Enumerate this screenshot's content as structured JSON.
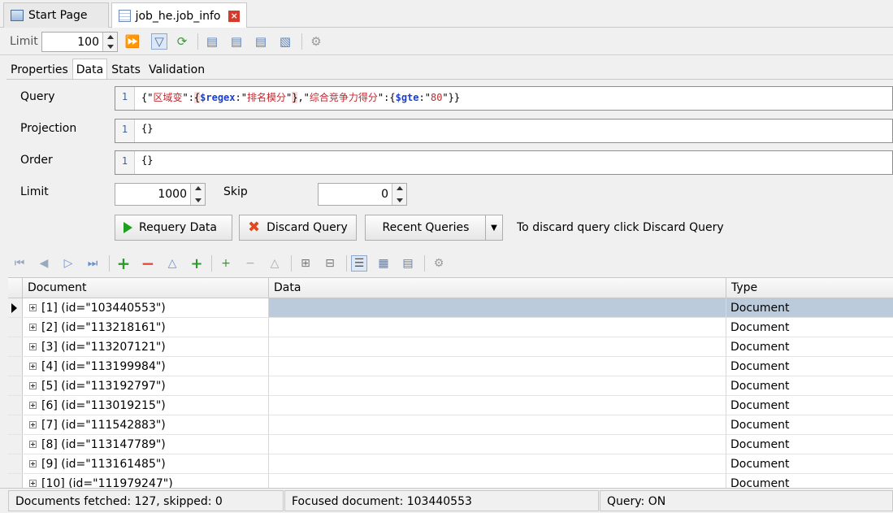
{
  "tabs": [
    {
      "label": "Start Page"
    },
    {
      "label": "job_he.job_info"
    }
  ],
  "toolbar": {
    "limit_label": "Limit",
    "limit_value": "100"
  },
  "subtabs": [
    "Properties",
    "Data",
    "Stats",
    "Validation"
  ],
  "query": {
    "query_label": "Query",
    "query_line": "1",
    "query_parts": [
      "{\"",
      "区域变",
      "\":",
      "{",
      "$regex",
      ":\"",
      "排名模分",
      "\"",
      "}",
      ",\"",
      "综合竞争力得分",
      "\":{",
      "$gte",
      ":\"",
      "80",
      "\"}}"
    ],
    "projection_label": "Projection",
    "projection_line": "1",
    "projection_code": "{}",
    "order_label": "Order",
    "order_line": "1",
    "order_code": "{}",
    "limit_label": "Limit",
    "limit_value": "1000",
    "skip_label": "Skip",
    "skip_value": "0",
    "requery_button": "Requery Data",
    "discard_button": "Discard Query",
    "recent_button": "Recent Queries",
    "hint": "To discard query click Discard Query"
  },
  "grid": {
    "columns": [
      "Document",
      "Data",
      "Type"
    ],
    "rows": [
      {
        "doc": "[1] (id=\"103440553\")",
        "data": "",
        "type": "Document"
      },
      {
        "doc": "[2] (id=\"113218161\")",
        "data": "",
        "type": "Document"
      },
      {
        "doc": "[3] (id=\"113207121\")",
        "data": "",
        "type": "Document"
      },
      {
        "doc": "[4] (id=\"113199984\")",
        "data": "",
        "type": "Document"
      },
      {
        "doc": "[5] (id=\"113192797\")",
        "data": "",
        "type": "Document"
      },
      {
        "doc": "[6] (id=\"113019215\")",
        "data": "",
        "type": "Document"
      },
      {
        "doc": "[7] (id=\"111542883\")",
        "data": "",
        "type": "Document"
      },
      {
        "doc": "[8] (id=\"113147789\")",
        "data": "",
        "type": "Document"
      },
      {
        "doc": "[9] (id=\"113161485\")",
        "data": "",
        "type": "Document"
      },
      {
        "doc": "[10] (id=\"111979247\")",
        "data": "",
        "type": "Document"
      }
    ]
  },
  "status": {
    "fetched": "Documents fetched: 127, skipped: 0",
    "focused": "Focused document: 103440553",
    "query": "Query: ON"
  }
}
